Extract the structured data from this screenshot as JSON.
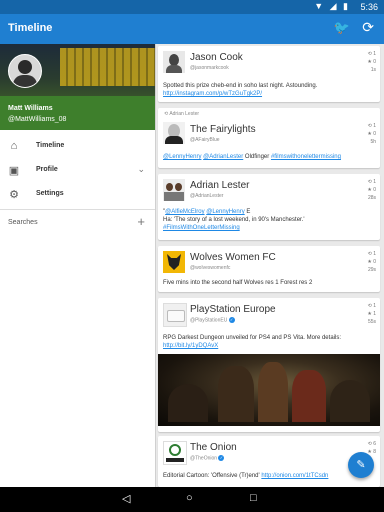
{
  "status": {
    "time": "5:36",
    "icons": "▼ ◢ ▮"
  },
  "appbar": {
    "title": "Timeline",
    "bird_icon": "twitter-bird-icon",
    "refresh_icon": "refresh-icon"
  },
  "drawer": {
    "user_name": "Matt Williams",
    "user_handle": "@MattWilliams_08",
    "items": [
      {
        "label": "Timeline",
        "icon": "home-icon"
      },
      {
        "label": "Profile",
        "icon": "account-box-icon"
      },
      {
        "label": "Settings",
        "icon": "gear-icon"
      }
    ],
    "searches_label": "Searches"
  },
  "tweets": [
    {
      "name": "Jason Cook",
      "handle": "@jasonmarkcook",
      "text": "Spotted this prize cheb-end in soho last night. Astounding.",
      "link": "http://instagram.com/p/wTzGuTgk2P/",
      "retweets": "1",
      "favorites": "0",
      "time": "1s"
    },
    {
      "retweeted_by": "Adrian Lester",
      "name": "The Fairylights",
      "handle": "@AFairyBlue",
      "mention1": "@LennyHenry",
      "mention2": "@AdrianLester",
      "text_mid": "Oldfinger",
      "hashtag": "#filmswithonelettermissing",
      "retweets": "1",
      "favorites": "0",
      "time": "5h"
    },
    {
      "name": "Adrian Lester",
      "handle": "@AdrianLester",
      "text_pre": "\"",
      "mention1": "@AlfieMcElroy",
      "mention2": "@LennyHenry",
      "text_mid": "E",
      "text_line2": "Ha: 'The story of a lost weekend, in 90's Manchester.'",
      "hashtag": "#FilmsWithOneLetterMissing",
      "retweets": "1",
      "favorites": "0",
      "time": "28s"
    },
    {
      "name": "Wolves Women FC",
      "handle": "@wolveswomenfc",
      "text": "Five mins into the second half Wolves res 1 Forest res 2",
      "retweets": "1",
      "favorites": "0",
      "time": "29s"
    },
    {
      "name": "PlayStation Europe",
      "handle": "@PlayStationEU",
      "text": "RPG Darkest Dungeon unveiled for PS4 and PS Vita. More details:",
      "link": "http://bit.ly/1yDQAvX",
      "retweets": "1",
      "favorites": "1",
      "time": "55s"
    },
    {
      "name": "The Onion",
      "handle": "@TheOnion",
      "text": "Editorial Cartoon: 'Offensive (Tr)end'",
      "link": "http://onion.com/1tTCsdn",
      "retweets": "6",
      "favorites": "8",
      "time": ""
    }
  ],
  "fab_icon": "compose-pencil-icon",
  "navbar": {
    "back": "◁",
    "home": "○",
    "recents": "□"
  },
  "colors": {
    "primary": "#1f7fd1",
    "status": "#1565a8",
    "link": "#1e88e5"
  }
}
